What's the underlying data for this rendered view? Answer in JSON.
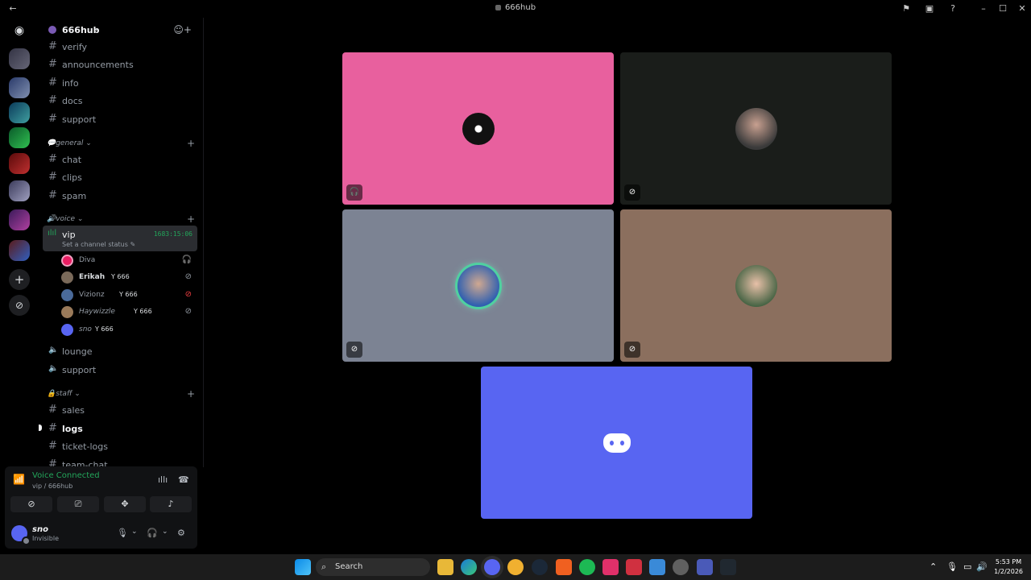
{
  "window": {
    "title": "666hub"
  },
  "server": {
    "name": "666hub"
  },
  "channels": {
    "top": [
      {
        "label": "verify"
      },
      {
        "label": "announcements"
      },
      {
        "label": "info"
      },
      {
        "label": "docs"
      },
      {
        "label": "support"
      }
    ],
    "general_category": "💬general",
    "general": [
      {
        "label": "chat"
      },
      {
        "label": "clips"
      },
      {
        "label": "spam"
      }
    ],
    "voice_category": "🔊voice",
    "vip": {
      "label": "vip",
      "timer": "1683:15:06",
      "status": "Set a channel status"
    },
    "members": [
      {
        "name": "Diva",
        "tag": "",
        "color": "#e91e63"
      },
      {
        "name": "Erikah",
        "tag": "Y 666",
        "color": "#7a6a5a"
      },
      {
        "name": "Vizionz",
        "tag": "Y 666",
        "color": "#4a6a9a"
      },
      {
        "name": "Haywizzle",
        "tag": "Y 666",
        "color": "#9a7a5a"
      },
      {
        "name": "sno",
        "tag": "Y 666",
        "color": "#5865f2"
      }
    ],
    "voice_other": [
      {
        "label": "lounge"
      },
      {
        "label": "support"
      }
    ],
    "staff_category": "🔒staff",
    "staff": [
      {
        "label": "sales"
      },
      {
        "label": "logs"
      },
      {
        "label": "ticket-logs"
      },
      {
        "label": "team-chat"
      }
    ]
  },
  "voice": {
    "status": "Voice Connected",
    "location": "vip / 666hub"
  },
  "user": {
    "name": "sno",
    "status": "Invisible"
  },
  "tiles": {
    "colors": [
      "#e8609e",
      "#1a1d1a",
      "#7c8393",
      "#8b6f5e",
      "#5865f2"
    ]
  },
  "taskbar": {
    "search": "Search",
    "time": "5:53 PM",
    "date": "1/2/2026"
  }
}
